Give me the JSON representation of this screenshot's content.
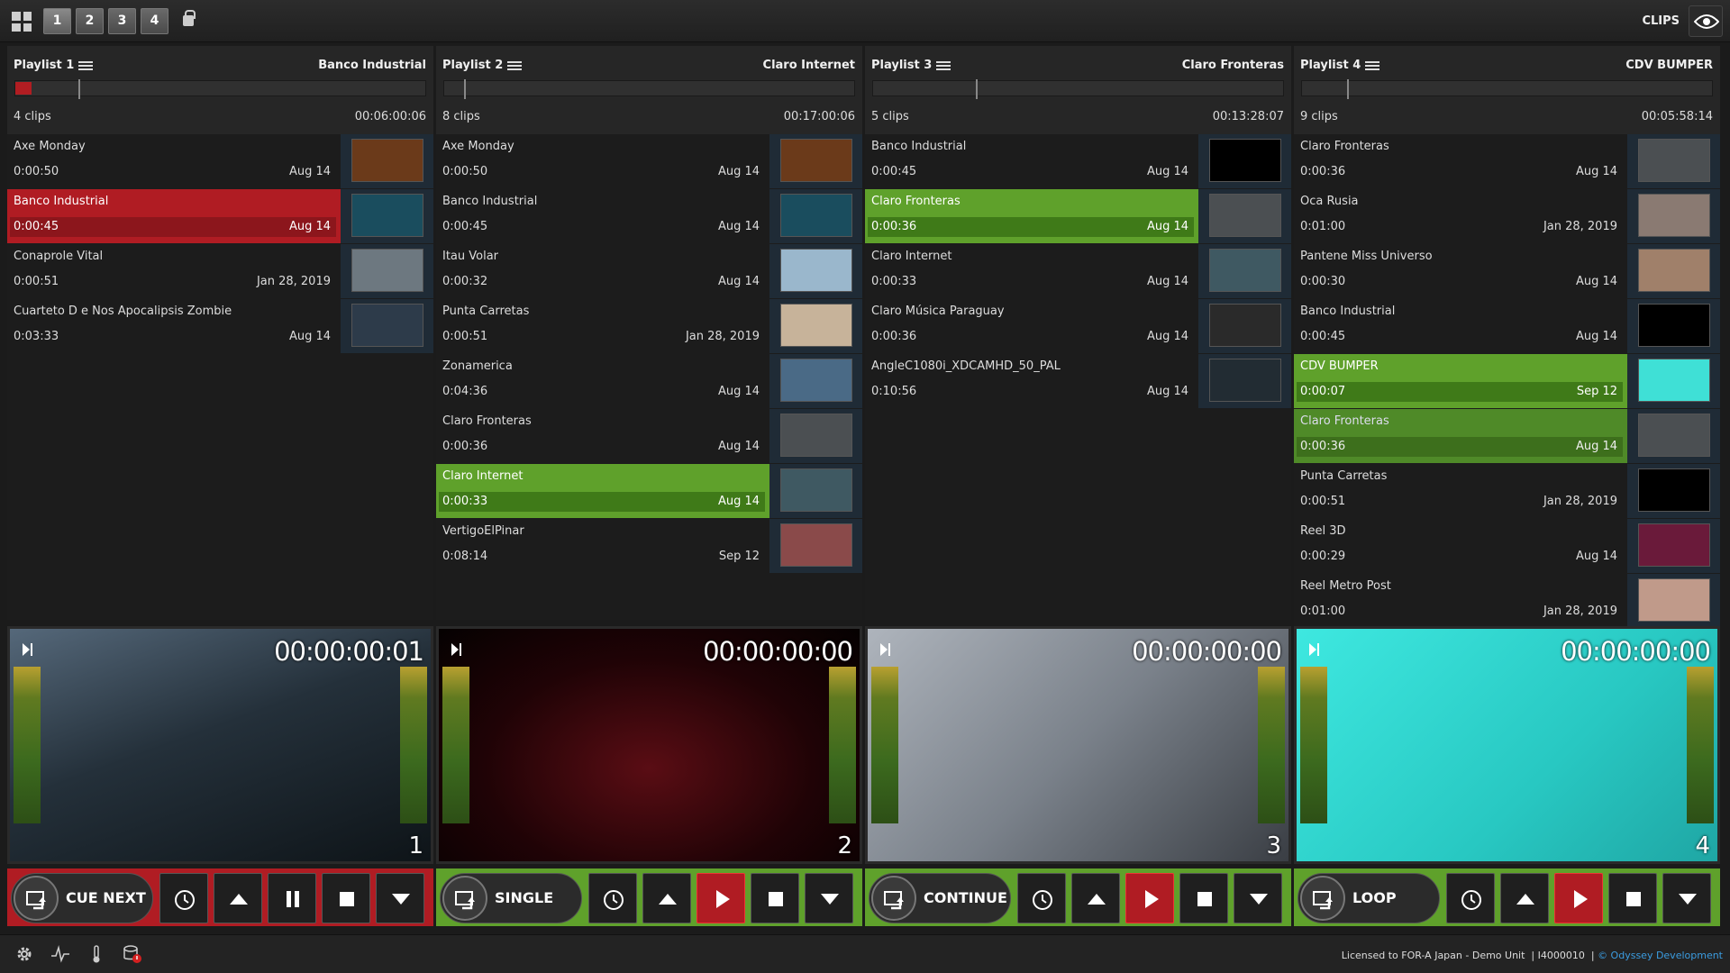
{
  "topbar": {
    "layouts": [
      "1",
      "2",
      "3",
      "4"
    ],
    "clips_label": "CLIPS"
  },
  "playlists": [
    {
      "title": "Playlist 1",
      "name": "Banco Industrial",
      "count": "4 clips",
      "duration": "00:06:00:06",
      "clips": [
        {
          "name": "Axe Monday",
          "dur": "0:00:50",
          "date": "Aug 14",
          "thumb": "#6b3a1a",
          "state": ""
        },
        {
          "name": "Banco Industrial",
          "dur": "0:00:45",
          "date": "Aug 14",
          "thumb": "#1a4d5e",
          "state": "red"
        },
        {
          "name": "Conaprole Vital",
          "dur": "0:00:51",
          "date": "Jan 28, 2019",
          "thumb": "#6d7880",
          "state": ""
        },
        {
          "name": "Cuarteto D e Nos Apocalipsis Zombie",
          "dur": "0:03:33",
          "date": "Aug 14",
          "thumb": "#2d3b4a",
          "state": ""
        }
      ],
      "timecode": "00:00:00:01",
      "channel": "1",
      "mode": "CUE NEXT",
      "play_state": "pause"
    },
    {
      "title": "Playlist 2",
      "name": "Claro Internet",
      "count": "8 clips",
      "duration": "00:17:00:06",
      "clips": [
        {
          "name": "Axe Monday",
          "dur": "0:00:50",
          "date": "Aug 14",
          "thumb": "#6b3a1a",
          "state": ""
        },
        {
          "name": "Banco Industrial",
          "dur": "0:00:45",
          "date": "Aug 14",
          "thumb": "#1a4d5e",
          "state": ""
        },
        {
          "name": "Itau Volar",
          "dur": "0:00:32",
          "date": "Aug 14",
          "thumb": "#9ab7cc",
          "state": ""
        },
        {
          "name": "Punta Carretas",
          "dur": "0:00:51",
          "date": "Jan 28, 2019",
          "thumb": "#c7b39a",
          "state": ""
        },
        {
          "name": "Zonamerica",
          "dur": "0:04:36",
          "date": "Aug 14",
          "thumb": "#4a6a86",
          "state": ""
        },
        {
          "name": "Claro Fronteras",
          "dur": "0:00:36",
          "date": "Aug 14",
          "thumb": "#4b4f52",
          "state": ""
        },
        {
          "name": "Claro Internet",
          "dur": "0:00:33",
          "date": "Aug 14",
          "thumb": "#3f5962",
          "state": "green"
        },
        {
          "name": "VertigoElPinar",
          "dur": "0:08:14",
          "date": "Sep 12",
          "thumb": "#8a4a4a",
          "state": ""
        }
      ],
      "timecode": "00:00:00:00",
      "channel": "2",
      "mode": "SINGLE",
      "play_state": "play"
    },
    {
      "title": "Playlist 3",
      "name": "Claro Fronteras",
      "count": "5 clips",
      "duration": "00:13:28:07",
      "clips": [
        {
          "name": "Banco Industrial",
          "dur": "0:00:45",
          "date": "Aug 14",
          "thumb": "#000000",
          "state": ""
        },
        {
          "name": "Claro Fronteras",
          "dur": "0:00:36",
          "date": "Aug 14",
          "thumb": "#4b4f52",
          "state": "green"
        },
        {
          "name": "Claro Internet",
          "dur": "0:00:33",
          "date": "Aug 14",
          "thumb": "#3f5962",
          "state": ""
        },
        {
          "name": "Claro Música Paraguay",
          "dur": "0:00:36",
          "date": "Aug 14",
          "thumb": "#2a2a2a",
          "state": ""
        },
        {
          "name": "AngleC1080i_XDCAMHD_50_PAL",
          "dur": "0:10:56",
          "date": "Aug 14",
          "thumb": "#222c33",
          "state": ""
        }
      ],
      "timecode": "00:00:00:00",
      "channel": "3",
      "mode": "CONTINUE",
      "play_state": "play"
    },
    {
      "title": "Playlist 4",
      "name": "CDV BUMPER",
      "count": "9 clips",
      "duration": "00:05:58:14",
      "clips": [
        {
          "name": "Claro Fronteras",
          "dur": "0:00:36",
          "date": "Aug 14",
          "thumb": "#4b4f52",
          "state": ""
        },
        {
          "name": "Oca Rusia",
          "dur": "0:01:00",
          "date": "Jan 28, 2019",
          "thumb": "#8a7a72",
          "state": ""
        },
        {
          "name": "Pantene Miss Universo",
          "dur": "0:00:30",
          "date": "Aug 14",
          "thumb": "#a0806a",
          "state": ""
        },
        {
          "name": "Banco Industrial",
          "dur": "0:00:45",
          "date": "Aug 14",
          "thumb": "#000000",
          "state": ""
        },
        {
          "name": "CDV BUMPER",
          "dur": "0:00:07",
          "date": "Sep 12",
          "thumb": "#3fe0d6",
          "state": "green"
        },
        {
          "name": "Claro Fronteras",
          "dur": "0:00:36",
          "date": "Aug 14",
          "thumb": "#4b4f52",
          "state": "green2"
        },
        {
          "name": "Punta Carretas",
          "dur": "0:00:51",
          "date": "Jan 28, 2019",
          "thumb": "#000000",
          "state": ""
        },
        {
          "name": "Reel 3D",
          "dur": "0:00:29",
          "date": "Aug 14",
          "thumb": "#6a1a3a",
          "state": ""
        },
        {
          "name": "Reel Metro Post",
          "dur": "0:01:00",
          "date": "Jan 28, 2019",
          "thumb": "#c09a8a",
          "state": ""
        }
      ],
      "timecode": "00:00:00:00",
      "channel": "4",
      "mode": "LOOP",
      "play_state": "play"
    }
  ],
  "status": {
    "license": "Licensed to FOR-A Japan - Demo Unit",
    "unit_id": "I4000010",
    "vendor": "© Odyssey Development"
  }
}
